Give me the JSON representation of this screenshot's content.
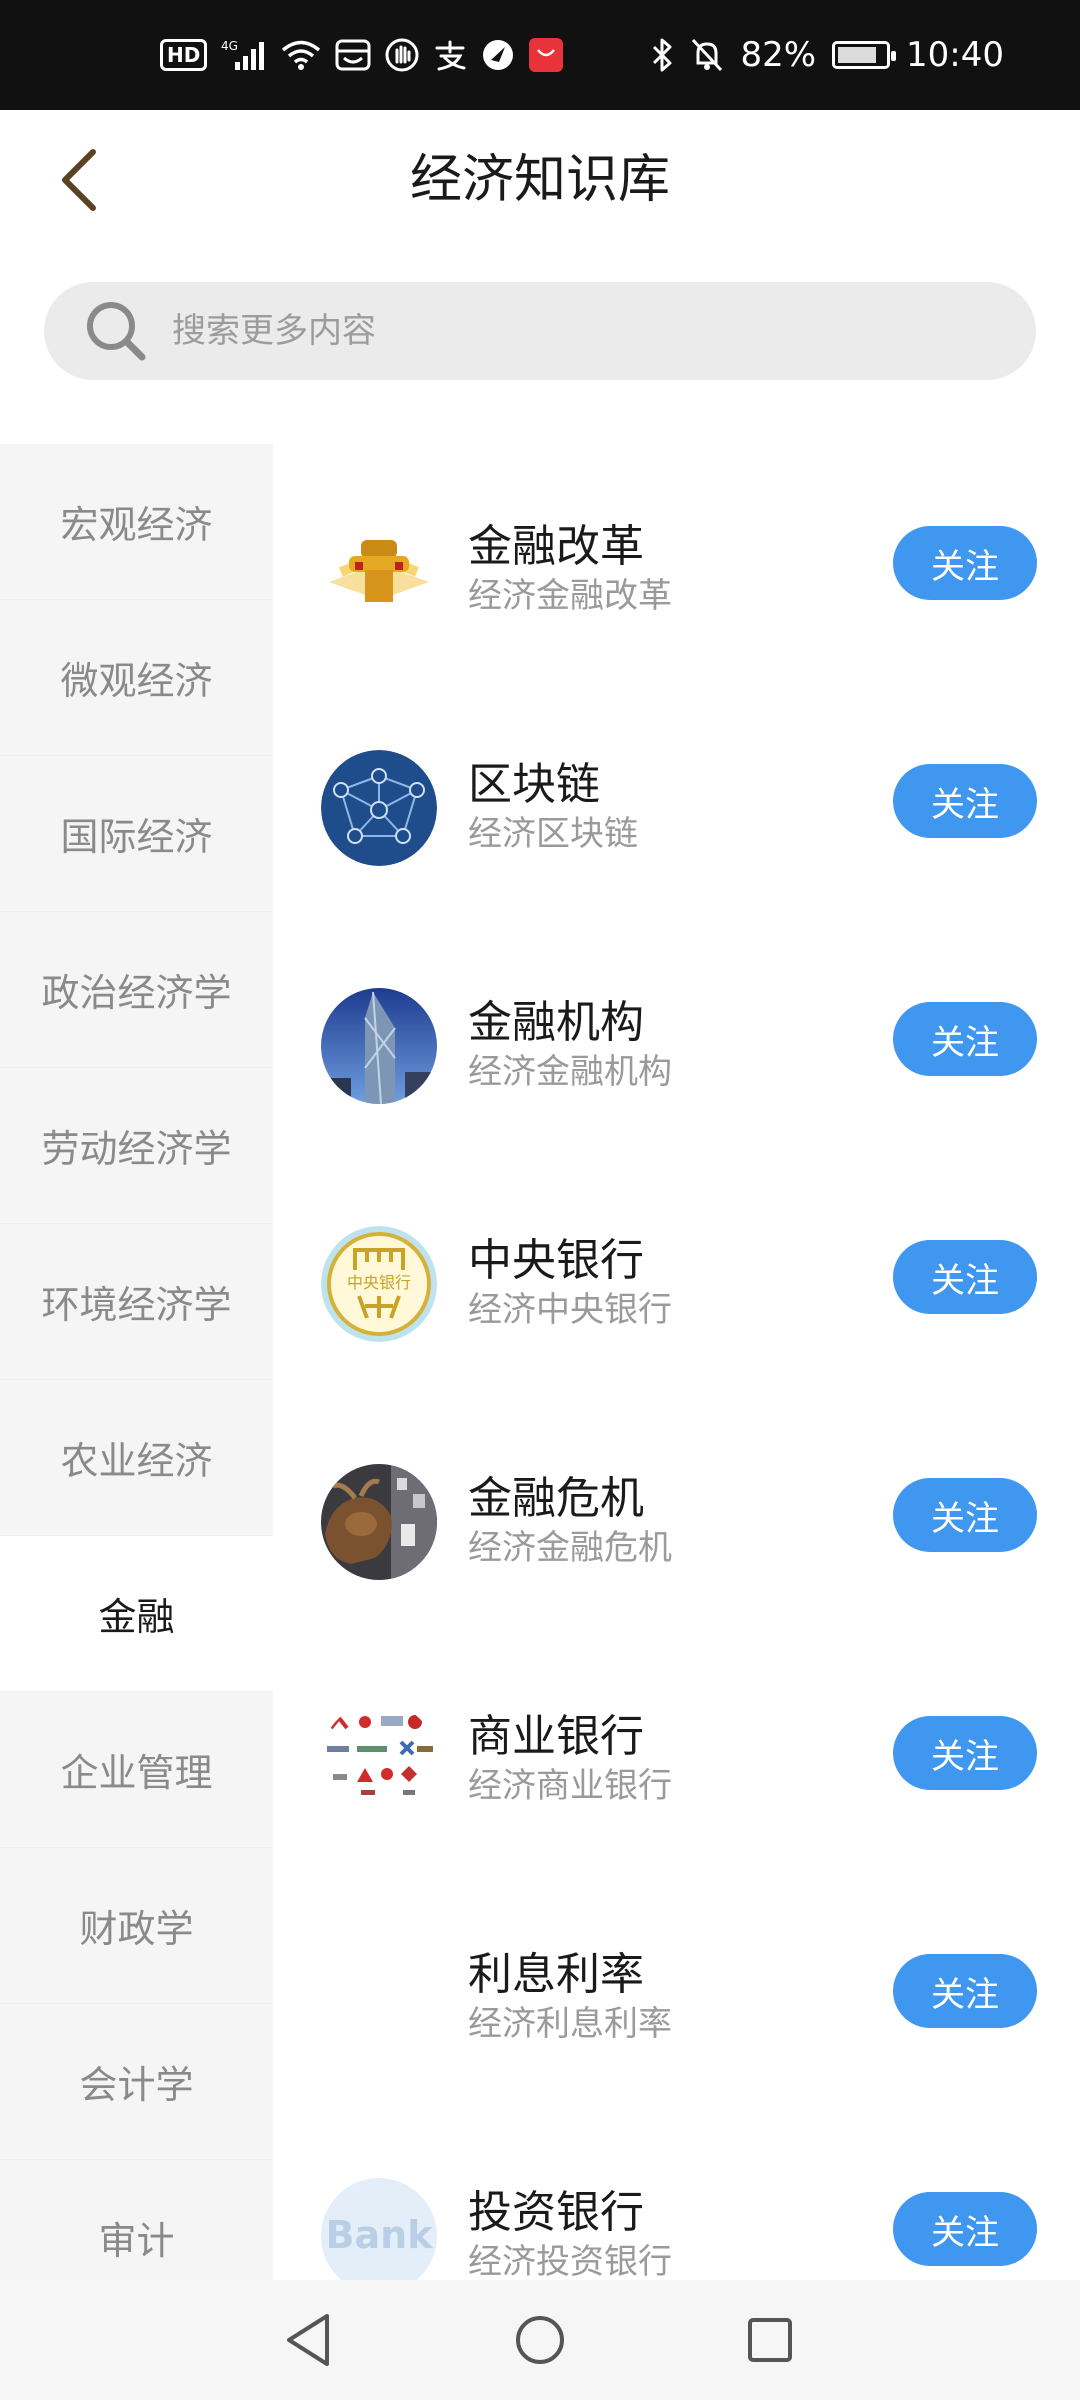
{
  "status_bar": {
    "hd": "HD",
    "network": "4G",
    "battery_percent": "82%",
    "battery_level": 0.82,
    "time": "10:40"
  },
  "header": {
    "title": "经济知识库"
  },
  "search": {
    "placeholder": "搜索更多内容"
  },
  "sidebar": {
    "items": [
      {
        "label": "宏观经济"
      },
      {
        "label": "微观经济"
      },
      {
        "label": "国际经济"
      },
      {
        "label": "政治经济学"
      },
      {
        "label": "劳动经济学"
      },
      {
        "label": "环境经济学"
      },
      {
        "label": "农业经济"
      },
      {
        "label": "金融"
      },
      {
        "label": "企业管理"
      },
      {
        "label": "财政学"
      },
      {
        "label": "会计学"
      },
      {
        "label": "审计"
      }
    ],
    "active_label": "金融"
  },
  "topics": [
    {
      "title": "金融改革",
      "subtitle": "经济金融改革",
      "follow_label": "关注",
      "icon": "reform-emblem-icon"
    },
    {
      "title": "区块链",
      "subtitle": "经济区块链",
      "follow_label": "关注",
      "icon": "blockchain-network-icon"
    },
    {
      "title": "金融机构",
      "subtitle": "经济金融机构",
      "follow_label": "关注",
      "icon": "bank-tower-icon"
    },
    {
      "title": "中央银行",
      "subtitle": "经济中央银行",
      "follow_label": "关注",
      "icon": "central-bank-logo-icon",
      "logo_text": "中央银行"
    },
    {
      "title": "金融危机",
      "subtitle": "经济金融危机",
      "follow_label": "关注",
      "icon": "bull-statue-icon"
    },
    {
      "title": "商业银行",
      "subtitle": "经济商业银行",
      "follow_label": "关注",
      "icon": "bank-logos-icon"
    },
    {
      "title": "利息利率",
      "subtitle": "经济利息利率",
      "follow_label": "关注",
      "icon": "blank-icon"
    },
    {
      "title": "投资银行",
      "subtitle": "经济投资银行",
      "follow_label": "关注",
      "icon": "bank-sign-icon",
      "logo_text": "Bank"
    }
  ],
  "colors": {
    "accent": "#3f97f0",
    "sidebar_bg": "#f5f5f5",
    "search_bg": "#ebebeb"
  },
  "nav": {
    "back": "back-triangle-icon",
    "home": "home-circle-icon",
    "recents": "recents-square-icon"
  }
}
